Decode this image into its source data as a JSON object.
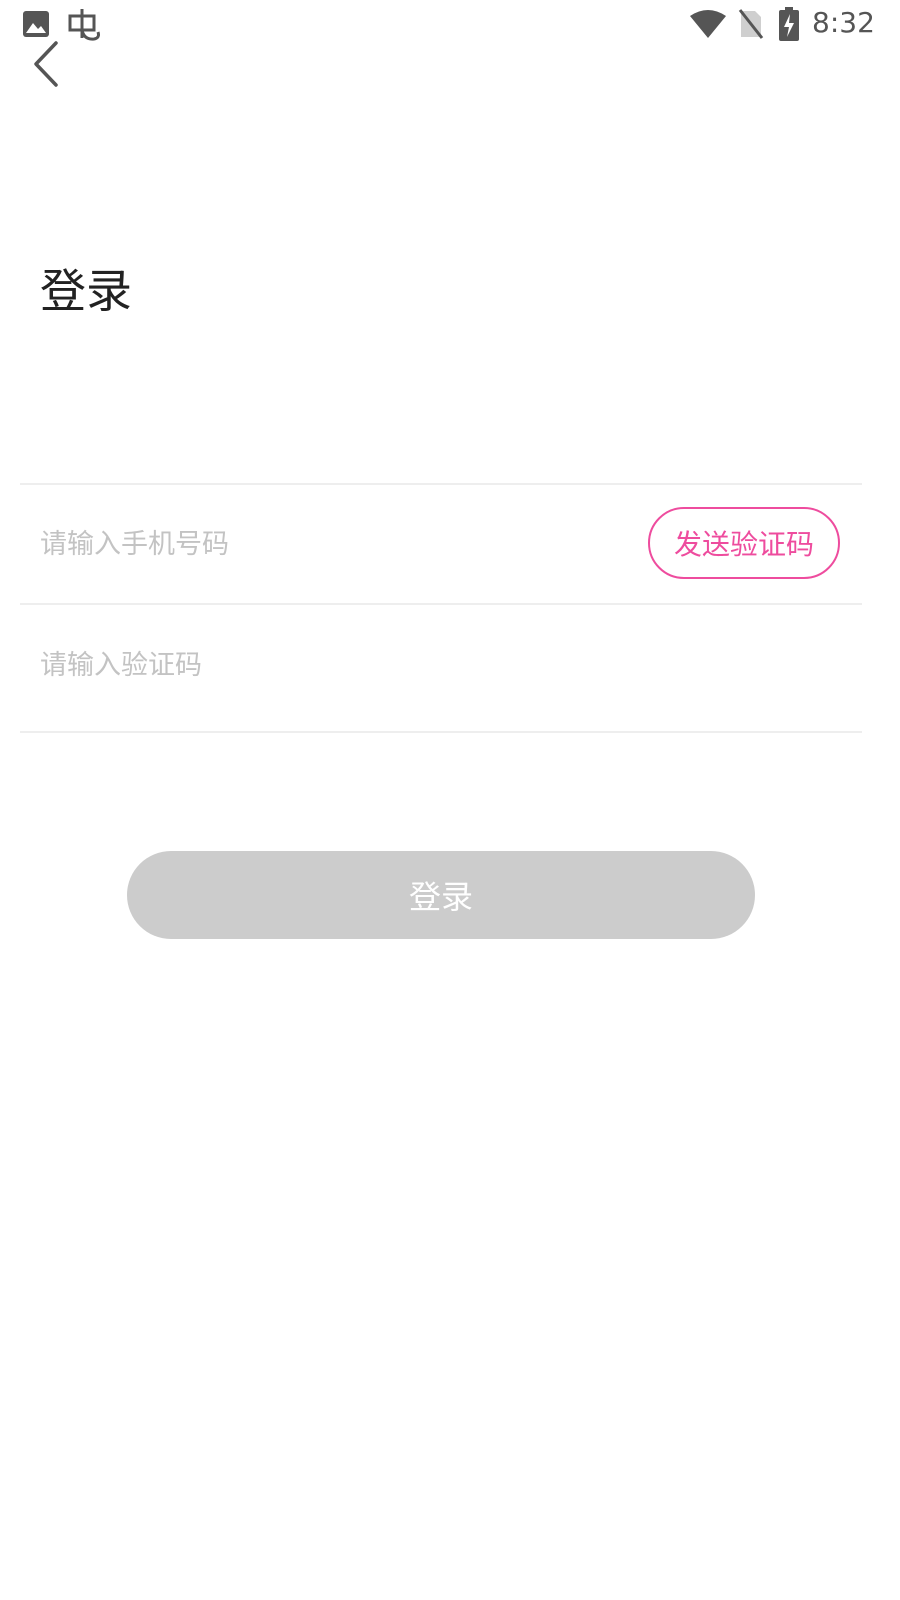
{
  "status_bar": {
    "time": "8:32",
    "left_icons": [
      "image-icon",
      "debug-bug-icon"
    ],
    "right_icons": [
      "wifi-icon",
      "no-sim-icon",
      "battery-charging-icon"
    ]
  },
  "header": {
    "back_icon": "chevron-left-icon"
  },
  "page": {
    "title": "登录"
  },
  "form": {
    "phone_placeholder": "请输入手机号码",
    "phone_value": "",
    "send_code_label": "发送验证码",
    "code_placeholder": "请输入验证码",
    "code_value": ""
  },
  "actions": {
    "login_label": "登录"
  },
  "colors": {
    "accent": "#ee4c9e",
    "login_disabled_bg": "#cccccc",
    "placeholder": "#c3c3c3",
    "divider": "#eeeeee"
  }
}
